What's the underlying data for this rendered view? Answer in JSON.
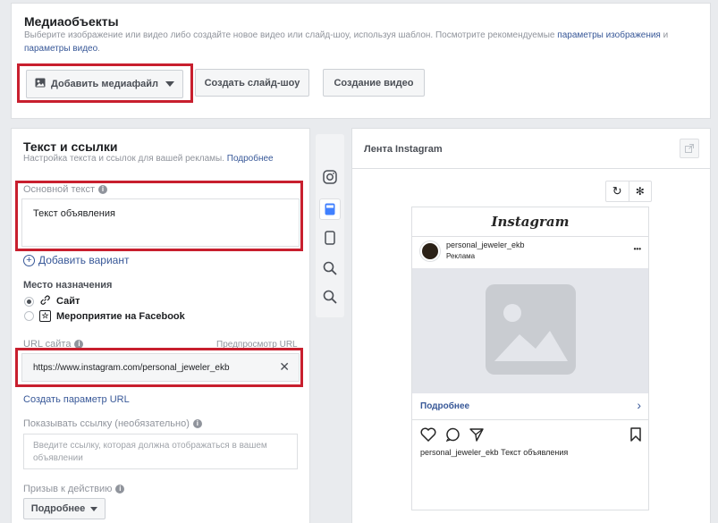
{
  "media": {
    "title": "Медиаобъекты",
    "desc_prefix": "Выберите изображение или видео либо создайте новое видео или слайд-шоу, используя шаблон. Посмотрите рекомендуемые",
    "desc_link1": "параметры изображения",
    "desc_and": "и",
    "desc_link2": "параметры видео",
    "desc_dot": ".",
    "add_button": "Добавить медиафайл",
    "slideshow_button": "Создать слайд-шоу",
    "video_button": "Создание видео"
  },
  "text_links": {
    "title": "Текст и ссылки",
    "desc": "Настройка текста и ссылок для вашей рекламы.",
    "desc_link": "Подробнее",
    "primary_text_label": "Основной текст",
    "primary_text_value": "Текст объявления",
    "add_variant": "Добавить вариант",
    "destination_label": "Место назначения",
    "dest_site": "Сайт",
    "dest_event": "Мероприятие на Facebook",
    "url_label": "URL сайта",
    "url_preview": "Предпросмотр URL",
    "url_value": "https://www.instagram.com/personal_jeweler_ekb",
    "create_url_param": "Создать параметр URL",
    "display_link_label": "Показывать ссылку",
    "display_link_optional": "(необязательно)",
    "display_link_placeholder": "Введите ссылку, которая должна отображаться в вашем объявлении",
    "cta_label": "Призыв к действию",
    "cta_value": "Подробнее"
  },
  "preview": {
    "title": "Лента Instagram",
    "ig_logo": "Instagram",
    "username": "personal_jeweler_ekb",
    "sponsored": "Реклама",
    "more": "•••",
    "cta": "Подробнее",
    "caption_user": "personal_jeweler_ekb",
    "caption_text": "Текст объявления"
  },
  "colors": {
    "accent": "#385898",
    "red_highlight": "#c81f2e",
    "placeholder_bg": "#e4e6eb"
  }
}
